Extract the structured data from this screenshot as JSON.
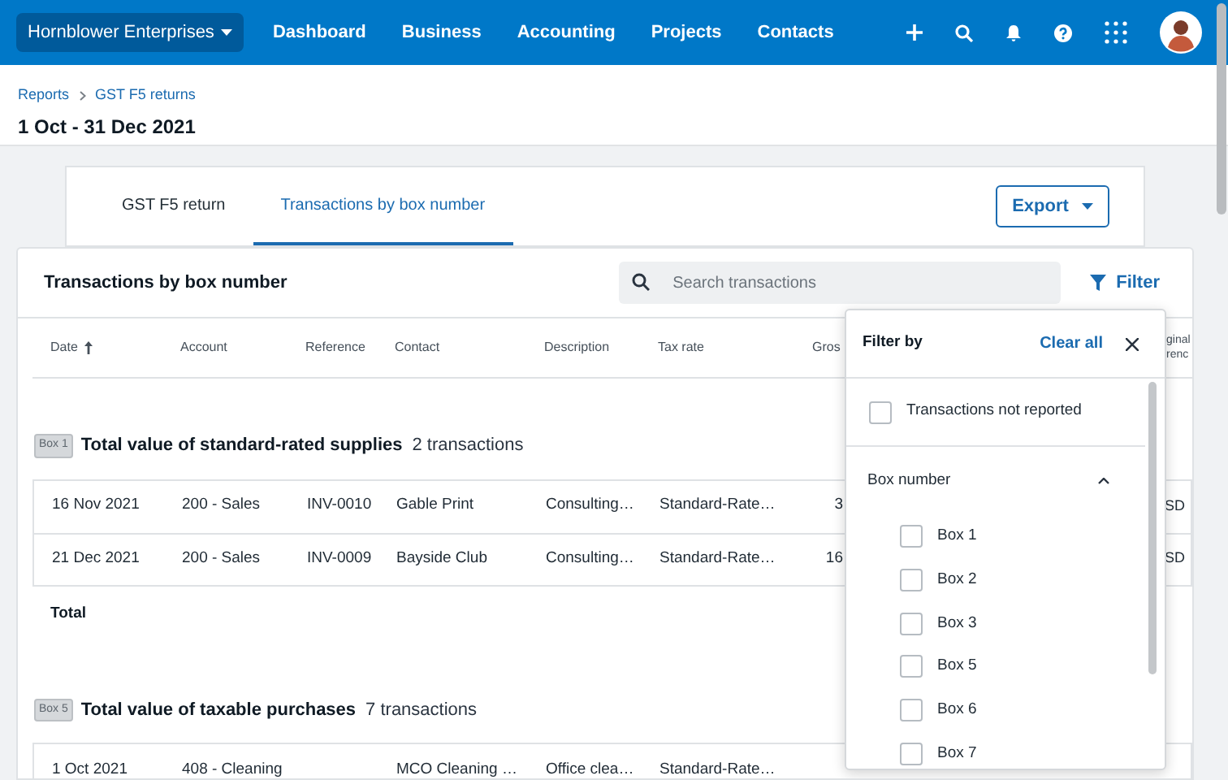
{
  "nav": {
    "org": "Hornblower Enterprises",
    "items": [
      "Dashboard",
      "Business",
      "Accounting",
      "Projects",
      "Contacts"
    ]
  },
  "breadcrumbs": [
    "Reports",
    "GST F5 returns"
  ],
  "period": "1 Oct - 31 Dec 2021",
  "tabs": [
    {
      "label": "GST F5 return",
      "selected": false
    },
    {
      "label": "Transactions by box number",
      "selected": true
    }
  ],
  "export": "Export",
  "card": {
    "title": "Transactions by box number",
    "search_placeholder": "Search transactions",
    "filter": "Filter"
  },
  "columns": [
    {
      "label": "Date",
      "sorted": true
    },
    {
      "label": "Account",
      "sorted": false
    },
    {
      "label": "Reference",
      "sorted": false
    },
    {
      "label": "Contact",
      "sorted": false
    },
    {
      "label": "Description",
      "sorted": false
    },
    {
      "label": "Tax rate",
      "sorted": false
    },
    {
      "label": "Gros",
      "sorted": false
    },
    {
      "label": "ginal renc",
      "sorted": false
    }
  ],
  "groups": [
    {
      "box": "Box 1",
      "title": "Total value of standard-rated supplies",
      "count": "2 transactions",
      "rows": [
        [
          "16 Nov 2021",
          "200 - Sales",
          "INV-0010",
          "Gable Print",
          "Consulting…",
          "Standard-Rate…",
          "3",
          "SD"
        ],
        [
          "21 Dec 2021",
          "200 - Sales",
          "INV-0009",
          "Bayside Club",
          "Consulting…",
          "Standard-Rate…",
          "16",
          "SD"
        ]
      ],
      "total": "Total"
    },
    {
      "box": "Box 5",
      "title": "Total value of taxable purchases",
      "count": "7 transactions",
      "rows": [
        [
          "1 Oct 2021",
          "408 - Cleaning",
          "",
          "MCO Cleaning …",
          "Office clea…",
          "Standard-Rate…",
          "",
          ""
        ]
      ]
    }
  ],
  "filter_panel": {
    "title": "Filter by",
    "clear": "Clear all",
    "not_reported": {
      "label": "Transactions not reported",
      "checked": false
    },
    "section": {
      "label": "Box number",
      "expanded": true
    },
    "options": [
      {
        "label": "Box 1",
        "checked": false
      },
      {
        "label": "Box 2",
        "checked": false
      },
      {
        "label": "Box 3",
        "checked": false
      },
      {
        "label": "Box 5",
        "checked": false
      },
      {
        "label": "Box 6",
        "checked": false
      },
      {
        "label": "Box 7",
        "checked": false
      }
    ]
  }
}
